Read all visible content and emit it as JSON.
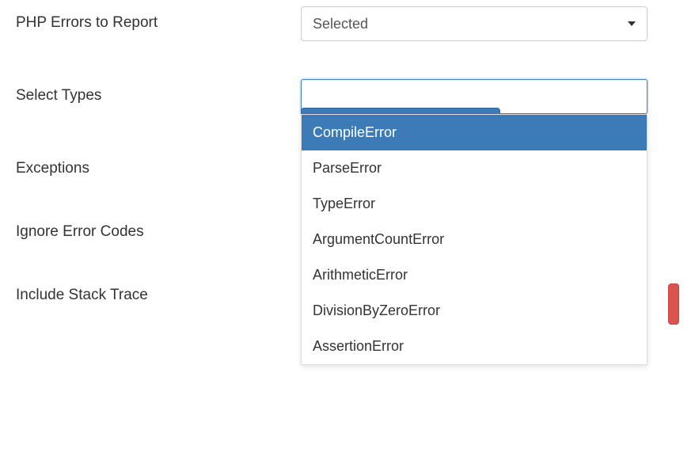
{
  "labels": {
    "php_errors": "PHP Errors to Report",
    "select_types": "Select Types",
    "exceptions": "Exceptions",
    "ignore_codes": "Ignore Error Codes",
    "stack_trace": "Include Stack Trace"
  },
  "php_errors_select": {
    "value": "Selected"
  },
  "types_input": {
    "value": "",
    "placeholder": ""
  },
  "types_options": [
    "CompileError",
    "ParseError",
    "TypeError",
    "ArgumentCountError",
    "ArithmeticError",
    "DivisionByZeroError",
    "AssertionError"
  ],
  "highlighted_index": 0
}
